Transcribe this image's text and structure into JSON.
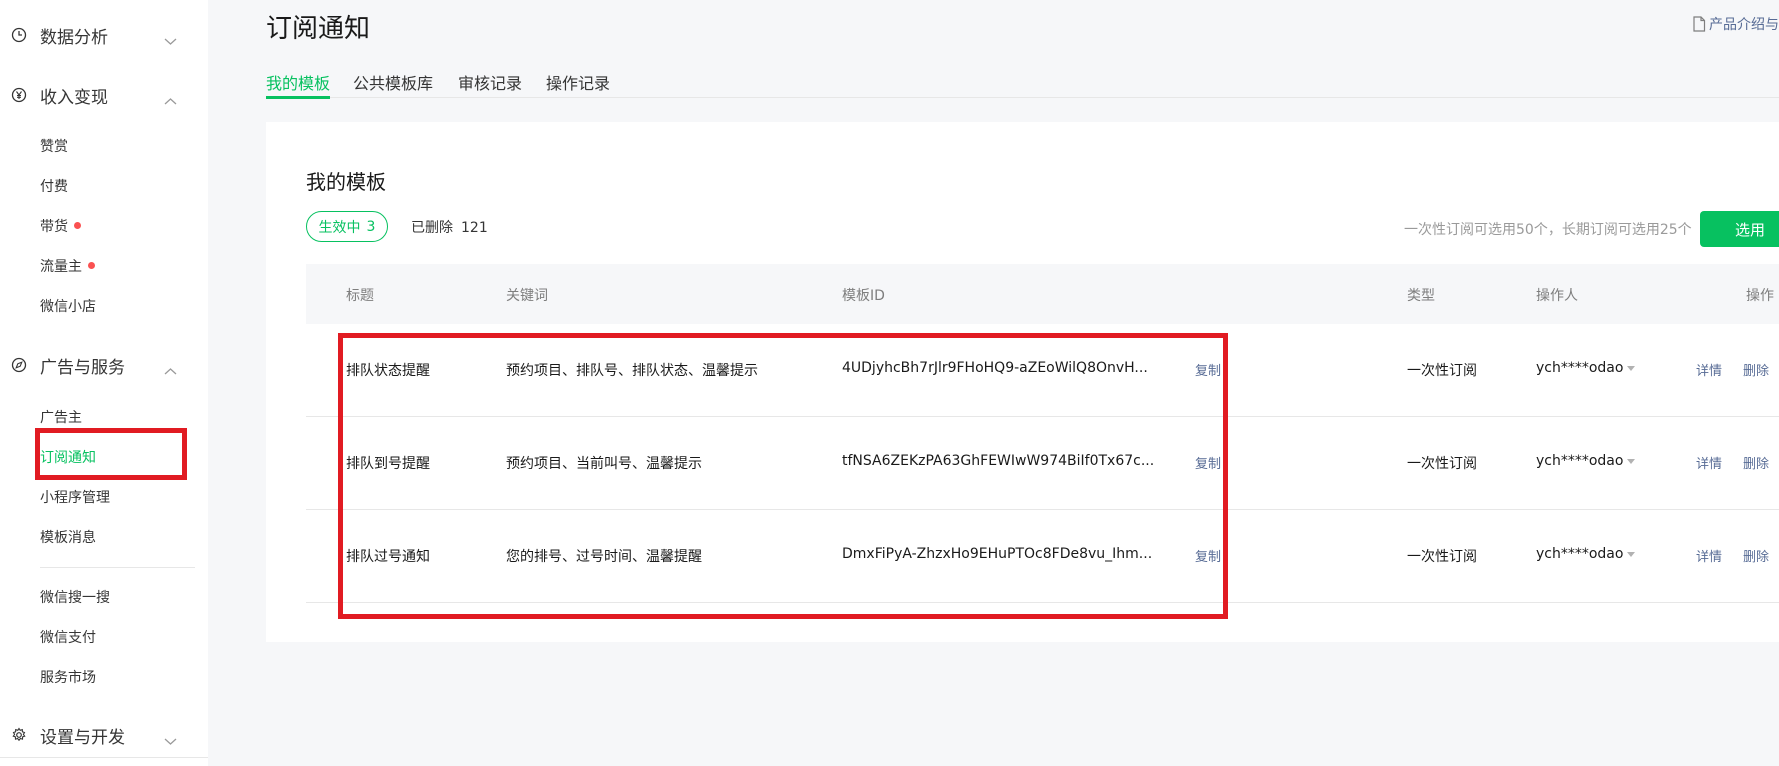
{
  "sidebar": {
    "groups": [
      {
        "label": "数据分析",
        "icon": "clock-icon",
        "expanded": false
      },
      {
        "label": "收入变现",
        "icon": "yen-icon",
        "expanded": true
      },
      {
        "label": "广告与服务",
        "icon": "compass-icon",
        "expanded": true
      },
      {
        "label": "设置与开发",
        "icon": "gear-icon",
        "expanded": false
      }
    ],
    "revenue_items": [
      {
        "label": "赞赏",
        "dot": false
      },
      {
        "label": "付费",
        "dot": false
      },
      {
        "label": "带货",
        "dot": true
      },
      {
        "label": "流量主",
        "dot": true
      },
      {
        "label": "微信小店",
        "dot": false
      }
    ],
    "ad_items": [
      {
        "label": "广告主",
        "active": false
      },
      {
        "label": "订阅通知",
        "active": true
      },
      {
        "label": "小程序管理",
        "active": false
      },
      {
        "label": "模板消息",
        "active": false
      }
    ],
    "other_items": [
      {
        "label": "微信搜一搜"
      },
      {
        "label": "微信支付"
      },
      {
        "label": "服务市场"
      }
    ]
  },
  "header": {
    "title": "订阅通知",
    "doc_link": "产品介绍与"
  },
  "tabs": [
    {
      "label": "我的模板",
      "active": true
    },
    {
      "label": "公共模板库",
      "active": false
    },
    {
      "label": "审核记录",
      "active": false
    },
    {
      "label": "操作记录",
      "active": false
    }
  ],
  "card": {
    "title": "我的模板",
    "filter_active_label": "生效中",
    "filter_active_count": "3",
    "filter_deleted_label": "已删除",
    "filter_deleted_count": "121",
    "hint": "一次性订阅可选用50个，长期订阅可选用25个",
    "select_button": "选用"
  },
  "table": {
    "columns": [
      "标题",
      "关键词",
      "模板ID",
      "类型",
      "操作人",
      "操作"
    ],
    "rows": [
      {
        "title": "排队状态提醒",
        "keywords": "预约项目、排队号、排队状态、温馨提示",
        "template_id": "4UDjyhcBh7rJlr9FHoHQ9-aZEoWilQ8OnvH...",
        "copy": "复制",
        "type": "一次性订阅",
        "operator": "ych****odao",
        "detail": "详情",
        "delete": "删除"
      },
      {
        "title": "排队到号提醒",
        "keywords": "预约项目、当前叫号、温馨提示",
        "template_id": "tfNSA6ZEKzPA63GhFEWIwW974BiIf0Tx67c...",
        "copy": "复制",
        "type": "一次性订阅",
        "operator": "ych****odao",
        "detail": "详情",
        "delete": "删除"
      },
      {
        "title": "排队过号通知",
        "keywords": "您的排号、过号时间、温馨提醒",
        "template_id": "DmxFiPyA-ZhzxHo9EHuPTOc8FDe8vu_Ihm...",
        "copy": "复制",
        "type": "一次性订阅",
        "operator": "ych****odao",
        "detail": "详情",
        "delete": "删除"
      }
    ]
  },
  "colors": {
    "accent": "#07c160",
    "link": "#576b95",
    "annotation": "#e11b22",
    "dot": "#fa5151"
  }
}
